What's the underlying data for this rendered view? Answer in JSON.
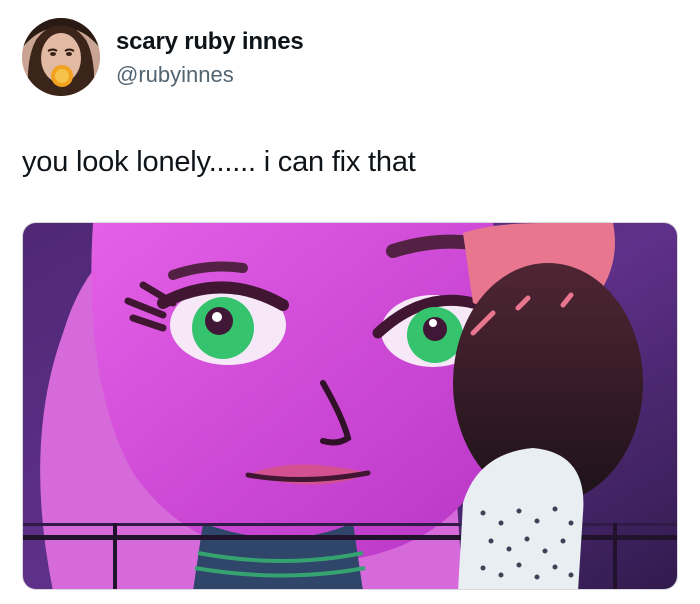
{
  "author": {
    "display_name": "scary ruby innes",
    "handle": "@rubyinnes",
    "avatar_icon": "profile-photo-avatar"
  },
  "tweet": {
    "text": "you look lonely...... i can fix that"
  },
  "media": {
    "description_icon": "attached-image",
    "colors": {
      "magenta": "#c83bd6",
      "deep_purple": "#3a1c5a",
      "eye_green": "#2fc26a"
    }
  }
}
